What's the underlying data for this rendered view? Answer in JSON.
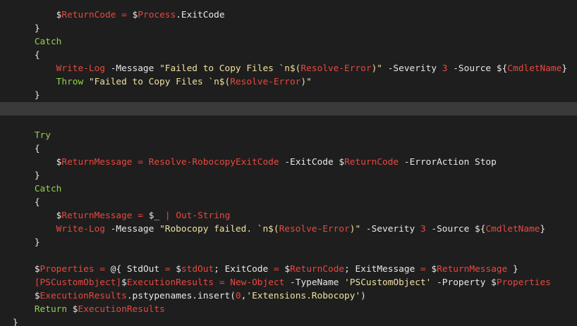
{
  "theme": {
    "background": "#1e1e1e",
    "current_line": "#3a3a3a",
    "default_text": "#e8e8e8",
    "variable_name": "#e8483e",
    "keyword": "#93d14e",
    "string": "#f0e0a0"
  },
  "lines": [
    {
      "indent": 8,
      "tokens": [
        {
          "c": "var",
          "t": "$"
        },
        {
          "c": "name",
          "t": "ReturnCode"
        },
        {
          "c": "punct",
          "t": " "
        },
        {
          "c": "op",
          "t": "="
        },
        {
          "c": "punct",
          "t": " "
        },
        {
          "c": "var",
          "t": "$"
        },
        {
          "c": "name",
          "t": "Process"
        },
        {
          "c": "punct",
          "t": ".ExitCode"
        }
      ]
    },
    {
      "indent": 4,
      "tokens": [
        {
          "c": "punct",
          "t": "}"
        }
      ]
    },
    {
      "indent": 4,
      "tokens": [
        {
          "c": "kw",
          "t": "Catch"
        }
      ]
    },
    {
      "indent": 4,
      "tokens": [
        {
          "c": "punct",
          "t": "{"
        }
      ]
    },
    {
      "indent": 8,
      "tokens": [
        {
          "c": "cmd",
          "t": "Write-Log"
        },
        {
          "c": "punct",
          "t": " "
        },
        {
          "c": "param",
          "t": "-Message"
        },
        {
          "c": "punct",
          "t": " "
        },
        {
          "c": "str",
          "t": "\"Failed to Copy Files `n$("
        },
        {
          "c": "cmd",
          "t": "Resolve-Error"
        },
        {
          "c": "str",
          "t": ")\""
        },
        {
          "c": "punct",
          "t": " "
        },
        {
          "c": "param",
          "t": "-Severity"
        },
        {
          "c": "punct",
          "t": " "
        },
        {
          "c": "num",
          "t": "3"
        },
        {
          "c": "punct",
          "t": " "
        },
        {
          "c": "param",
          "t": "-Source"
        },
        {
          "c": "punct",
          "t": " "
        },
        {
          "c": "var",
          "t": "${"
        },
        {
          "c": "name",
          "t": "CmdletName"
        },
        {
          "c": "var",
          "t": "}"
        }
      ]
    },
    {
      "indent": 8,
      "tokens": [
        {
          "c": "kw",
          "t": "Throw"
        },
        {
          "c": "punct",
          "t": " "
        },
        {
          "c": "str",
          "t": "\"Failed to Copy Files `n$("
        },
        {
          "c": "cmd",
          "t": "Resolve-Error"
        },
        {
          "c": "str",
          "t": ")\""
        }
      ]
    },
    {
      "indent": 4,
      "tokens": [
        {
          "c": "punct",
          "t": "}"
        }
      ]
    },
    {
      "indent": 0,
      "current": true,
      "tokens": []
    },
    {
      "indent": 0,
      "tokens": []
    },
    {
      "indent": 4,
      "tokens": [
        {
          "c": "kw",
          "t": "Try"
        }
      ]
    },
    {
      "indent": 4,
      "tokens": [
        {
          "c": "punct",
          "t": "{"
        }
      ]
    },
    {
      "indent": 8,
      "tokens": [
        {
          "c": "var",
          "t": "$"
        },
        {
          "c": "name",
          "t": "ReturnMessage"
        },
        {
          "c": "punct",
          "t": " "
        },
        {
          "c": "op",
          "t": "="
        },
        {
          "c": "punct",
          "t": " "
        },
        {
          "c": "cmd",
          "t": "Resolve-RobocopyExitCode"
        },
        {
          "c": "punct",
          "t": " "
        },
        {
          "c": "param",
          "t": "-ExitCode"
        },
        {
          "c": "punct",
          "t": " "
        },
        {
          "c": "var",
          "t": "$"
        },
        {
          "c": "name",
          "t": "ReturnCode"
        },
        {
          "c": "punct",
          "t": " "
        },
        {
          "c": "param",
          "t": "-ErrorAction"
        },
        {
          "c": "punct",
          "t": " Stop"
        }
      ]
    },
    {
      "indent": 4,
      "tokens": [
        {
          "c": "punct",
          "t": "}"
        }
      ]
    },
    {
      "indent": 4,
      "tokens": [
        {
          "c": "kw",
          "t": "Catch"
        }
      ]
    },
    {
      "indent": 4,
      "tokens": [
        {
          "c": "punct",
          "t": "{"
        }
      ]
    },
    {
      "indent": 8,
      "tokens": [
        {
          "c": "var",
          "t": "$"
        },
        {
          "c": "name",
          "t": "ReturnMessage"
        },
        {
          "c": "punct",
          "t": " "
        },
        {
          "c": "op",
          "t": "="
        },
        {
          "c": "punct",
          "t": " "
        },
        {
          "c": "var",
          "t": "$_"
        },
        {
          "c": "punct",
          "t": " "
        },
        {
          "c": "op",
          "t": "|"
        },
        {
          "c": "punct",
          "t": " "
        },
        {
          "c": "cmd",
          "t": "Out-String"
        }
      ]
    },
    {
      "indent": 8,
      "tokens": [
        {
          "c": "cmd",
          "t": "Write-Log"
        },
        {
          "c": "punct",
          "t": " "
        },
        {
          "c": "param",
          "t": "-Message"
        },
        {
          "c": "punct",
          "t": " "
        },
        {
          "c": "str",
          "t": "\"Robocopy failed. `n$("
        },
        {
          "c": "cmd",
          "t": "Resolve-Error"
        },
        {
          "c": "str",
          "t": ")\""
        },
        {
          "c": "punct",
          "t": " "
        },
        {
          "c": "param",
          "t": "-Severity"
        },
        {
          "c": "punct",
          "t": " "
        },
        {
          "c": "num",
          "t": "3"
        },
        {
          "c": "punct",
          "t": " "
        },
        {
          "c": "param",
          "t": "-Source"
        },
        {
          "c": "punct",
          "t": " "
        },
        {
          "c": "var",
          "t": "${"
        },
        {
          "c": "name",
          "t": "CmdletName"
        },
        {
          "c": "var",
          "t": "}"
        }
      ]
    },
    {
      "indent": 4,
      "tokens": [
        {
          "c": "punct",
          "t": "}"
        }
      ]
    },
    {
      "indent": 0,
      "tokens": []
    },
    {
      "indent": 4,
      "tokens": [
        {
          "c": "var",
          "t": "$"
        },
        {
          "c": "name",
          "t": "Properties"
        },
        {
          "c": "punct",
          "t": " "
        },
        {
          "c": "op",
          "t": "="
        },
        {
          "c": "punct",
          "t": " @{ StdOut "
        },
        {
          "c": "op",
          "t": "="
        },
        {
          "c": "punct",
          "t": " "
        },
        {
          "c": "var",
          "t": "$"
        },
        {
          "c": "name",
          "t": "stdOut"
        },
        {
          "c": "punct",
          "t": "; ExitCode "
        },
        {
          "c": "op",
          "t": "="
        },
        {
          "c": "punct",
          "t": " "
        },
        {
          "c": "var",
          "t": "$"
        },
        {
          "c": "name",
          "t": "ReturnCode"
        },
        {
          "c": "punct",
          "t": "; ExitMessage "
        },
        {
          "c": "op",
          "t": "="
        },
        {
          "c": "punct",
          "t": " "
        },
        {
          "c": "var",
          "t": "$"
        },
        {
          "c": "name",
          "t": "ReturnMessage"
        },
        {
          "c": "punct",
          "t": " }"
        }
      ]
    },
    {
      "indent": 4,
      "tokens": [
        {
          "c": "type",
          "t": "[PSCustomObject]"
        },
        {
          "c": "var",
          "t": "$"
        },
        {
          "c": "name",
          "t": "ExecutionResults"
        },
        {
          "c": "punct",
          "t": " "
        },
        {
          "c": "op",
          "t": "="
        },
        {
          "c": "punct",
          "t": " "
        },
        {
          "c": "cmd",
          "t": "New-Object"
        },
        {
          "c": "punct",
          "t": " "
        },
        {
          "c": "param",
          "t": "-TypeName"
        },
        {
          "c": "punct",
          "t": " "
        },
        {
          "c": "str",
          "t": "'PSCustomObject'"
        },
        {
          "c": "punct",
          "t": " "
        },
        {
          "c": "param",
          "t": "-Property"
        },
        {
          "c": "punct",
          "t": " "
        },
        {
          "c": "var",
          "t": "$"
        },
        {
          "c": "name",
          "t": "Properties"
        }
      ]
    },
    {
      "indent": 4,
      "tokens": [
        {
          "c": "var",
          "t": "$"
        },
        {
          "c": "name",
          "t": "ExecutionResults"
        },
        {
          "c": "punct",
          "t": ".pstypenames.insert("
        },
        {
          "c": "num",
          "t": "0"
        },
        {
          "c": "punct",
          "t": ","
        },
        {
          "c": "str",
          "t": "'Extensions.Robocopy'"
        },
        {
          "c": "punct",
          "t": ")"
        }
      ]
    },
    {
      "indent": 4,
      "tokens": [
        {
          "c": "kw",
          "t": "Return"
        },
        {
          "c": "punct",
          "t": " "
        },
        {
          "c": "var",
          "t": "$"
        },
        {
          "c": "name",
          "t": "ExecutionResults"
        }
      ]
    },
    {
      "indent": 0,
      "tokens": [
        {
          "c": "punct",
          "t": "}"
        }
      ]
    }
  ]
}
